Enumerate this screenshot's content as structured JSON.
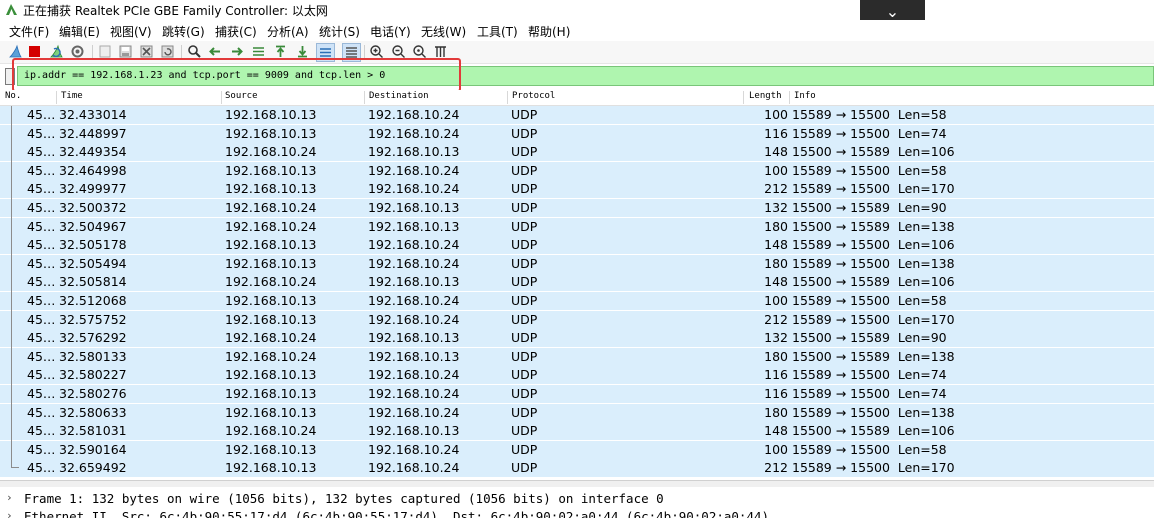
{
  "window": {
    "title": "正在捕获 Realtek PCIe GBE Family Controller: 以太网",
    "dropdown_glyph": "⌄"
  },
  "menu": [
    {
      "label": "文件(F)",
      "name": "file"
    },
    {
      "label": "编辑(E)",
      "name": "edit"
    },
    {
      "label": "视图(V)",
      "name": "view"
    },
    {
      "label": "跳转(G)",
      "name": "go"
    },
    {
      "label": "捕获(C)",
      "name": "capture"
    },
    {
      "label": "分析(A)",
      "name": "analyze"
    },
    {
      "label": "统计(S)",
      "name": "statistics"
    },
    {
      "label": "电话(Y)",
      "name": "telephony"
    },
    {
      "label": "无线(W)",
      "name": "wireless"
    },
    {
      "label": "工具(T)",
      "name": "tools"
    },
    {
      "label": "帮助(H)",
      "name": "help"
    }
  ],
  "toolbar": {
    "icons": [
      "shark-fin-icon",
      "stop-capture-icon",
      "restart-capture-icon",
      "capture-options-icon",
      "open-file-icon",
      "save-file-icon",
      "close-file-icon",
      "reload-file-icon",
      "find-packet-icon",
      "go-back-icon",
      "go-forward-icon",
      "go-to-packet-icon",
      "go-first-icon",
      "go-last-icon",
      "auto-scroll-icon",
      "colorize-icon",
      "zoom-in-icon",
      "zoom-out-icon",
      "zoom-normal-icon",
      "resize-columns-icon"
    ],
    "colors": {
      "stop": "#d40000",
      "fin": "#5aa0d8",
      "accent": "#2b6fb6"
    }
  },
  "filter": {
    "value": "ip.addr == 192.168.1.23 and tcp.port == 9009 and tcp.len > 0",
    "valid_color": "#aff5af",
    "highlight_color": "#e23a3a"
  },
  "columns": {
    "no": "No.",
    "time": "Time",
    "source": "Source",
    "destination": "Destination",
    "protocol": "Protocol",
    "length": "Length",
    "info": "Info"
  },
  "packets": [
    {
      "no": "45…",
      "time": "32.433014",
      "src": "192.168.10.13",
      "dst": "192.168.10.24",
      "proto": "UDP",
      "len": "100",
      "info": "15589 → 15500  Len=58"
    },
    {
      "no": "45…",
      "time": "32.448997",
      "src": "192.168.10.13",
      "dst": "192.168.10.24",
      "proto": "UDP",
      "len": "116",
      "info": "15589 → 15500  Len=74"
    },
    {
      "no": "45…",
      "time": "32.449354",
      "src": "192.168.10.24",
      "dst": "192.168.10.13",
      "proto": "UDP",
      "len": "148",
      "info": "15500 → 15589  Len=106"
    },
    {
      "no": "45…",
      "time": "32.464998",
      "src": "192.168.10.13",
      "dst": "192.168.10.24",
      "proto": "UDP",
      "len": "100",
      "info": "15589 → 15500  Len=58"
    },
    {
      "no": "45…",
      "time": "32.499977",
      "src": "192.168.10.13",
      "dst": "192.168.10.24",
      "proto": "UDP",
      "len": "212",
      "info": "15589 → 15500  Len=170"
    },
    {
      "no": "45…",
      "time": "32.500372",
      "src": "192.168.10.24",
      "dst": "192.168.10.13",
      "proto": "UDP",
      "len": "132",
      "info": "15500 → 15589  Len=90"
    },
    {
      "no": "45…",
      "time": "32.504967",
      "src": "192.168.10.24",
      "dst": "192.168.10.13",
      "proto": "UDP",
      "len": "180",
      "info": "15500 → 15589  Len=138"
    },
    {
      "no": "45…",
      "time": "32.505178",
      "src": "192.168.10.13",
      "dst": "192.168.10.24",
      "proto": "UDP",
      "len": "148",
      "info": "15589 → 15500  Len=106"
    },
    {
      "no": "45…",
      "time": "32.505494",
      "src": "192.168.10.13",
      "dst": "192.168.10.24",
      "proto": "UDP",
      "len": "180",
      "info": "15589 → 15500  Len=138"
    },
    {
      "no": "45…",
      "time": "32.505814",
      "src": "192.168.10.24",
      "dst": "192.168.10.13",
      "proto": "UDP",
      "len": "148",
      "info": "15500 → 15589  Len=106"
    },
    {
      "no": "45…",
      "time": "32.512068",
      "src": "192.168.10.13",
      "dst": "192.168.10.24",
      "proto": "UDP",
      "len": "100",
      "info": "15589 → 15500  Len=58"
    },
    {
      "no": "45…",
      "time": "32.575752",
      "src": "192.168.10.13",
      "dst": "192.168.10.24",
      "proto": "UDP",
      "len": "212",
      "info": "15589 → 15500  Len=170"
    },
    {
      "no": "45…",
      "time": "32.576292",
      "src": "192.168.10.24",
      "dst": "192.168.10.13",
      "proto": "UDP",
      "len": "132",
      "info": "15500 → 15589  Len=90"
    },
    {
      "no": "45…",
      "time": "32.580133",
      "src": "192.168.10.24",
      "dst": "192.168.10.13",
      "proto": "UDP",
      "len": "180",
      "info": "15500 → 15589  Len=138"
    },
    {
      "no": "45…",
      "time": "32.580227",
      "src": "192.168.10.13",
      "dst": "192.168.10.24",
      "proto": "UDP",
      "len": "116",
      "info": "15589 → 15500  Len=74"
    },
    {
      "no": "45…",
      "time": "32.580276",
      "src": "192.168.10.13",
      "dst": "192.168.10.24",
      "proto": "UDP",
      "len": "116",
      "info": "15589 → 15500  Len=74"
    },
    {
      "no": "45…",
      "time": "32.580633",
      "src": "192.168.10.13",
      "dst": "192.168.10.24",
      "proto": "UDP",
      "len": "180",
      "info": "15589 → 15500  Len=138"
    },
    {
      "no": "45…",
      "time": "32.581031",
      "src": "192.168.10.24",
      "dst": "192.168.10.13",
      "proto": "UDP",
      "len": "148",
      "info": "15500 → 15589  Len=106"
    },
    {
      "no": "45…",
      "time": "32.590164",
      "src": "192.168.10.13",
      "dst": "192.168.10.24",
      "proto": "UDP",
      "len": "100",
      "info": "15589 → 15500  Len=58"
    },
    {
      "no": "45…",
      "time": "32.659492",
      "src": "192.168.10.13",
      "dst": "192.168.10.24",
      "proto": "UDP",
      "len": "212",
      "info": "15589 → 15500  Len=170"
    }
  ],
  "row_color": "#daeefc",
  "details": [
    {
      "chevron": "›",
      "text": "Frame 1: 132 bytes on wire (1056 bits), 132 bytes captured (1056 bits) on interface 0"
    },
    {
      "chevron": "›",
      "text": "Ethernet II, Src: 6c:4b:90:55:17:d4 (6c:4b:90:55:17:d4), Dst: 6c:4b:90:02:a0:44 (6c:4b:90:02:a0:44)"
    }
  ]
}
